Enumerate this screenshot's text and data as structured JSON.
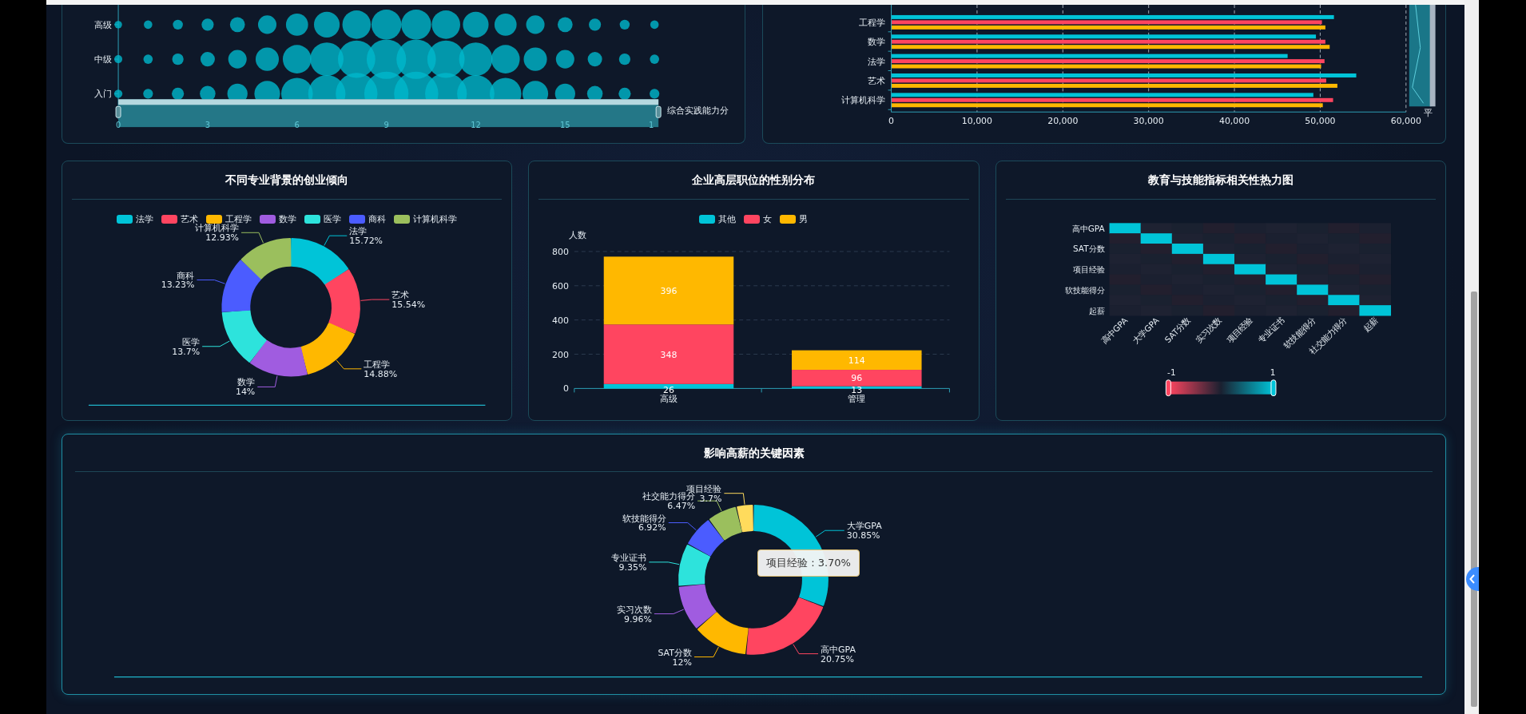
{
  "bubble_panel": {
    "y_labels": [
      "高级",
      "中级",
      "入门"
    ],
    "zoom_slider": {
      "level": 1
    },
    "x_tick_labels": [
      "0",
      "3",
      "6",
      "9",
      "12",
      "15",
      "1"
    ],
    "x_title": "综合实践能力分"
  },
  "salary_panel": {
    "chart_data": {
      "type": "bar",
      "orientation": "horizontal",
      "grid": true,
      "categories": [
        "工程学",
        "数学",
        "法学",
        "艺术",
        "计算机科学"
      ],
      "series": [
        {
          "color": "#00c4d8",
          "values": [
            51600,
            49500,
            46200,
            54200,
            49200
          ]
        },
        {
          "color": "#ff4560",
          "values": [
            50200,
            50600,
            50500,
            50700,
            51500
          ]
        },
        {
          "color": "#ffb800",
          "values": [
            50600,
            51100,
            50100,
            52000,
            50300
          ]
        }
      ],
      "xlim": [
        0,
        60000
      ],
      "xticks": [
        {
          "value": 0,
          "label": "0"
        },
        {
          "value": 10000,
          "label": "10,000"
        },
        {
          "value": 20000,
          "label": "20,000"
        },
        {
          "value": 30000,
          "label": "30,000"
        },
        {
          "value": 40000,
          "label": "40,000"
        },
        {
          "value": 50000,
          "label": "50,000"
        },
        {
          "value": 60000,
          "label": "60,000"
        }
      ]
    },
    "slider_label": "平",
    "zoom_slider": {
      "level": 1
    }
  },
  "entrepreneurship_panel": {
    "title": "不同专业背景的创业倾向",
    "legend": [
      {
        "label": "法学"
      },
      {
        "label": "艺术"
      },
      {
        "label": "工程学"
      },
      {
        "label": "数学"
      },
      {
        "label": "医学"
      },
      {
        "label": "商科"
      },
      {
        "label": "计算机科学"
      }
    ],
    "chart_data": {
      "type": "donut",
      "categories": [
        "法学",
        "艺术",
        "工程学",
        "数学",
        "医学",
        "商科",
        "计算机科学"
      ],
      "values": [
        15.72,
        15.54,
        14.88,
        14,
        13.7,
        13.23,
        12.93
      ],
      "value_labels": [
        "15.72%",
        "15.54%",
        "14.88%",
        "14%",
        "13.7%",
        "13.23%",
        "12.93%"
      ],
      "colors": [
        "#00c4d8",
        "#ff4560",
        "#ffb800",
        "#a05ce0",
        "#2de3dc",
        "#4b5cff",
        "#9bbf5d"
      ]
    }
  },
  "gender_panel": {
    "title": "企业高层职位的性别分布",
    "chart_data": {
      "type": "bar",
      "stacked": true,
      "grid": true,
      "ylabel": "人数",
      "categories": [
        "高级",
        "管理"
      ],
      "series": [
        {
          "name": "其他",
          "color": "#00c4d8",
          "values": [
            26,
            13
          ]
        },
        {
          "name": "女",
          "color": "#ff4560",
          "values": [
            348,
            96
          ]
        },
        {
          "name": "男",
          "color": "#ffb800",
          "values": [
            396,
            114
          ]
        }
      ],
      "ylim": [
        0,
        800
      ],
      "yticks": [
        0,
        200,
        400,
        600,
        800
      ],
      "data_labels": true
    }
  },
  "heatmap_panel": {
    "title": "教育与技能指标相关性热力图",
    "y_labels": [
      "高中GPA",
      "SAT分数",
      "项目经验",
      "软技能得分",
      "起薪"
    ],
    "x_labels": [
      "高中GPA",
      "大学GPA",
      "SAT分数",
      "实习次数",
      "项目经验",
      "专业证书",
      "软技能得分",
      "社交能力得分",
      "起薪"
    ],
    "scale_min": "-1",
    "scale_max": "1"
  },
  "factors_panel": {
    "title": "影响高薪的关键因素",
    "chart_data": {
      "type": "donut",
      "categories": [
        "大学GPA",
        "高中GPA",
        "SAT分数",
        "实习次数",
        "专业证书",
        "软技能得分",
        "社交能力得分",
        "项目经验"
      ],
      "values": [
        30.85,
        20.75,
        12,
        9.96,
        9.35,
        6.92,
        6.47,
        3.7
      ],
      "value_labels": [
        "30.85%",
        "20.75%",
        "12%",
        "9.96%",
        "9.35%",
        "6.92%",
        "6.47%",
        "3.7%"
      ],
      "colors": [
        "#00c4d8",
        "#ff4560",
        "#ffb800",
        "#a05ce0",
        "#2de3dc",
        "#4b5cff",
        "#9bbf5d",
        "#ffdb5c"
      ]
    },
    "tooltip": "项目经验 : 3.70%"
  }
}
